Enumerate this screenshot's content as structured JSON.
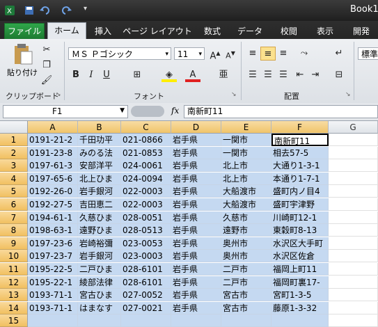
{
  "window": {
    "title": "Book1"
  },
  "ribbon_tabs": [
    "ファイル",
    "ホーム",
    "挿入",
    "ページ レイアウト",
    "数式",
    "データ",
    "校閲",
    "表示",
    "開発"
  ],
  "ribbon": {
    "paste_label": "貼り付け",
    "font_name": "ＭＳ Ｐゴシック",
    "font_size": "11",
    "style_box": "標準",
    "group_clipboard": "クリップボード",
    "group_font": "フォント",
    "group_alignment": "配置"
  },
  "formula_bar": {
    "name_box": "F1",
    "fx": "fx",
    "content": "南新町11"
  },
  "columns": [
    "A",
    "B",
    "C",
    "D",
    "E",
    "F",
    "G"
  ],
  "rows": [
    {
      "n": "1",
      "A": "0191-21-2",
      "B": "千田功平",
      "C": "021-0866",
      "D": "岩手県",
      "E": "一関市",
      "F": "南新町11"
    },
    {
      "n": "2",
      "A": "0191-23-8",
      "B": "みのる法",
      "C": "021-0853",
      "D": "岩手県",
      "E": "一関市",
      "F": "相去57-5"
    },
    {
      "n": "3",
      "A": "0197-61-3",
      "B": "安部洋平",
      "C": "024-0061",
      "D": "岩手県",
      "E": "北上市",
      "F": "大通り1-3-1"
    },
    {
      "n": "4",
      "A": "0197-65-6",
      "B": "北上ひま",
      "C": "024-0094",
      "D": "岩手県",
      "E": "北上市",
      "F": "本通り1-7-1"
    },
    {
      "n": "5",
      "A": "0192-26-0",
      "B": "岩手銀河",
      "C": "022-0003",
      "D": "岩手県",
      "E": "大船渡市",
      "F": "盛町内ノ目4"
    },
    {
      "n": "6",
      "A": "0192-27-5",
      "B": "吉田恵二",
      "C": "022-0003",
      "D": "岩手県",
      "E": "大船渡市",
      "F": "盛町宇津野"
    },
    {
      "n": "7",
      "A": "0194-61-1",
      "B": "久慈ひま",
      "C": "028-0051",
      "D": "岩手県",
      "E": "久慈市",
      "F": "川崎町12-1"
    },
    {
      "n": "8",
      "A": "0198-63-1",
      "B": "遠野ひま",
      "C": "028-0513",
      "D": "岩手県",
      "E": "遠野市",
      "F": "東穀町8-13"
    },
    {
      "n": "9",
      "A": "0197-23-6",
      "B": "岩崎裕彌",
      "C": "023-0053",
      "D": "岩手県",
      "E": "奥州市",
      "F": "水沢区大手町"
    },
    {
      "n": "10",
      "A": "0197-23-7",
      "B": "岩手銀河",
      "C": "023-0003",
      "D": "岩手県",
      "E": "奥州市",
      "F": "水沢区佐倉"
    },
    {
      "n": "11",
      "A": "0195-22-5",
      "B": "二戸ひま",
      "C": "028-6101",
      "D": "岩手県",
      "E": "二戸市",
      "F": "福岡上町11"
    },
    {
      "n": "12",
      "A": "0195-22-1",
      "B": "綾部法律",
      "C": "028-6101",
      "D": "岩手県",
      "E": "二戸市",
      "F": "福岡町裏17-"
    },
    {
      "n": "13",
      "A": "0193-71-1",
      "B": "宮古ひま",
      "C": "027-0052",
      "D": "岩手県",
      "E": "宮古市",
      "F": "宮町1-3-5"
    },
    {
      "n": "14",
      "A": "0193-71-1",
      "B": "はまなす",
      "C": "027-0021",
      "D": "岩手県",
      "E": "宮古市",
      "F": "藤原1-3-32"
    },
    {
      "n": "15",
      "A": "",
      "B": "",
      "C": "",
      "D": "",
      "E": "",
      "F": ""
    }
  ]
}
